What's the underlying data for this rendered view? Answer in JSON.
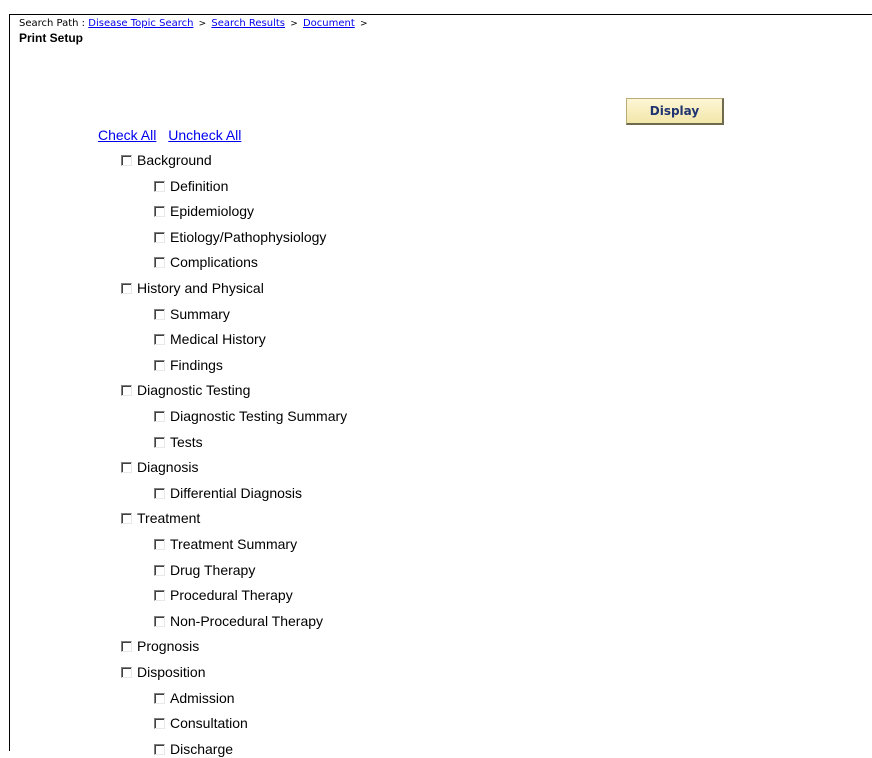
{
  "breadcrumb": {
    "prefix": "Search Path :",
    "links": [
      "Disease Topic Search",
      "Search Results",
      "Document"
    ],
    "separator": ">"
  },
  "page_title": "Print Setup",
  "display_button": "Display",
  "check_all": "Check All",
  "uncheck_all": "Uncheck All",
  "sections": [
    {
      "label": "Background",
      "children": [
        "Definition",
        "Epidemiology",
        "Etiology/Pathophysiology",
        "Complications"
      ]
    },
    {
      "label": "History and Physical",
      "children": [
        "Summary",
        "Medical History",
        "Findings"
      ]
    },
    {
      "label": "Diagnostic Testing",
      "children": [
        "Diagnostic Testing Summary",
        "Tests"
      ]
    },
    {
      "label": "Diagnosis",
      "children": [
        "Differential Diagnosis"
      ]
    },
    {
      "label": "Treatment",
      "children": [
        "Treatment Summary",
        "Drug Therapy",
        "Procedural Therapy",
        "Non-Procedural Therapy"
      ]
    },
    {
      "label": "Prognosis",
      "children": []
    },
    {
      "label": "Disposition",
      "children": [
        "Admission",
        "Consultation",
        "Discharge"
      ]
    }
  ]
}
